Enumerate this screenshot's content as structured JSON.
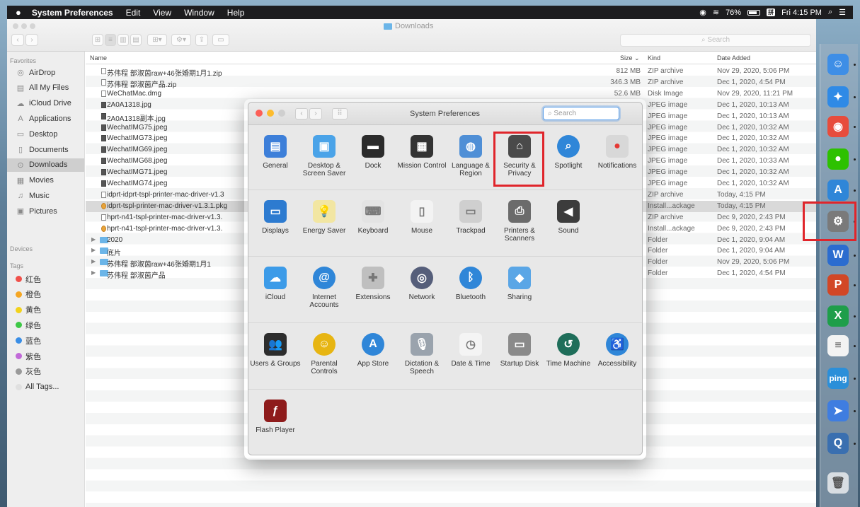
{
  "menubar": {
    "apple_icon": "apple-logo",
    "items": [
      "System Preferences",
      "Edit",
      "View",
      "Window",
      "Help"
    ],
    "battery": "76%",
    "clock": "Fri 4:15 PM"
  },
  "finder": {
    "title": "Downloads",
    "search_placeholder": "Search",
    "sidebar": {
      "favorites_header": "Favorites",
      "favorites": [
        {
          "label": "AirDrop",
          "icon": "airdrop-icon"
        },
        {
          "label": "All My Files",
          "icon": "files-icon"
        },
        {
          "label": "iCloud Drive",
          "icon": "cloud-icon"
        },
        {
          "label": "Applications",
          "icon": "applications-icon"
        },
        {
          "label": "Desktop",
          "icon": "desktop-icon"
        },
        {
          "label": "Documents",
          "icon": "documents-icon"
        },
        {
          "label": "Downloads",
          "icon": "downloads-icon"
        },
        {
          "label": "Movies",
          "icon": "movies-icon"
        },
        {
          "label": "Music",
          "icon": "music-icon"
        },
        {
          "label": "Pictures",
          "icon": "pictures-icon"
        }
      ],
      "devices_header": "Devices",
      "tags_header": "Tags",
      "tags": [
        {
          "label": "红色",
          "color": "#f0504a"
        },
        {
          "label": "橙色",
          "color": "#f5a623"
        },
        {
          "label": "黄色",
          "color": "#f2d21b"
        },
        {
          "label": "绿色",
          "color": "#3ec846"
        },
        {
          "label": "蓝色",
          "color": "#3a8ee6"
        },
        {
          "label": "紫色",
          "color": "#c16ad8"
        },
        {
          "label": "灰色",
          "color": "#9a9a9a"
        },
        {
          "label": "All Tags...",
          "color": "#e0e0e0"
        }
      ]
    },
    "columns": {
      "name": "Name",
      "size": "Size",
      "kind": "Kind",
      "date": "Date Added"
    },
    "files": [
      {
        "name": "苏伟程 部淑茵raw+46张婚期1月1.zip",
        "size": "812 MB",
        "kind": "ZIP archive",
        "date": "Nov 29, 2020, 5:06 PM",
        "type": "doc"
      },
      {
        "name": "苏伟程 部淑茵产品.zip",
        "size": "346.3 MB",
        "kind": "ZIP archive",
        "date": "Dec 1, 2020, 4:54 PM",
        "type": "doc"
      },
      {
        "name": "WeChatMac.dmg",
        "size": "52.6 MB",
        "kind": "Disk Image",
        "date": "Nov 29, 2020, 11:21 PM",
        "type": "doc"
      },
      {
        "name": "2A0A1318.jpg",
        "size": "",
        "kind": "JPEG image",
        "date": "Dec 1, 2020, 10:13 AM",
        "type": "img"
      },
      {
        "name": "2A0A1318副本.jpg",
        "size": "",
        "kind": "JPEG image",
        "date": "Dec 1, 2020, 10:13 AM",
        "type": "img"
      },
      {
        "name": "WechatIMG75.jpeg",
        "size": "",
        "kind": "JPEG image",
        "date": "Dec 1, 2020, 10:32 AM",
        "type": "img"
      },
      {
        "name": "WechatIMG73.jpeg",
        "size": "",
        "kind": "JPEG image",
        "date": "Dec 1, 2020, 10:32 AM",
        "type": "img"
      },
      {
        "name": "WechatIMG69.jpeg",
        "size": "",
        "kind": "JPEG image",
        "date": "Dec 1, 2020, 10:32 AM",
        "type": "img"
      },
      {
        "name": "WechatIMG68.jpeg",
        "size": "",
        "kind": "JPEG image",
        "date": "Dec 1, 2020, 10:33 AM",
        "type": "img"
      },
      {
        "name": "WechatIMG71.jpeg",
        "size": "",
        "kind": "JPEG image",
        "date": "Dec 1, 2020, 10:32 AM",
        "type": "img"
      },
      {
        "name": "WechatIMG74.jpeg",
        "size": "",
        "kind": "JPEG image",
        "date": "Dec 1, 2020, 10:32 AM",
        "type": "img"
      },
      {
        "name": "idprt-idprt-tspl-printer-mac-driver-v1.3",
        "size": "",
        "kind": "ZIP archive",
        "date": "Today, 4:15 PM",
        "type": "doc"
      },
      {
        "name": "idprt-tspl-printer-mac-driver-v1.3.1.pkg",
        "size": "",
        "kind": "Install...ackage",
        "date": "Today, 4:15 PM",
        "type": "pkg"
      },
      {
        "name": "hprt-n41-tspl-printer-mac-driver-v1.3.",
        "size": "",
        "kind": "ZIP archive",
        "date": "Dec 9, 2020, 2:43 PM",
        "type": "doc"
      },
      {
        "name": "hprt-n41-tspl-printer-mac-driver-v1.3.",
        "size": "",
        "kind": "Install...ackage",
        "date": "Dec 9, 2020, 2:43 PM",
        "type": "pkg"
      },
      {
        "name": "2020",
        "size": "",
        "kind": "Folder",
        "date": "Dec 1, 2020, 9:04 AM",
        "type": "dir"
      },
      {
        "name": "底片",
        "size": "",
        "kind": "Folder",
        "date": "Dec 1, 2020, 9:04 AM",
        "type": "dir"
      },
      {
        "name": "苏伟程 部淑茵raw+46张婚期1月1",
        "size": "",
        "kind": "Folder",
        "date": "Nov 29, 2020, 5:06 PM",
        "type": "dir"
      },
      {
        "name": "苏伟程 部淑茵产品",
        "size": "",
        "kind": "Folder",
        "date": "Dec 1, 2020, 4:54 PM",
        "type": "dir"
      }
    ]
  },
  "sysprefs": {
    "title": "System Preferences",
    "search_placeholder": "Search",
    "sections": [
      [
        {
          "label": "General",
          "icon": "general-icon",
          "color": "#3d7fd9"
        },
        {
          "label": "Desktop & Screen Saver",
          "icon": "desktop-screensaver-icon",
          "color": "#4aa3e8"
        },
        {
          "label": "Dock",
          "icon": "dock-icon",
          "color": "#2b2b2b"
        },
        {
          "label": "Mission Control",
          "icon": "mission-control-icon",
          "color": "#333333"
        },
        {
          "label": "Language & Region",
          "icon": "language-region-icon",
          "color": "#4f8fd6"
        },
        {
          "label": "Security & Privacy",
          "icon": "security-privacy-icon",
          "color": "#4a4a4a"
        },
        {
          "label": "Spotlight",
          "icon": "spotlight-icon",
          "color": "#2f86d8"
        },
        {
          "label": "Notifications",
          "icon": "notifications-icon",
          "color": "#d8d8d8"
        }
      ],
      [
        {
          "label": "Displays",
          "icon": "displays-icon",
          "color": "#2d7bd0"
        },
        {
          "label": "Energy Saver",
          "icon": "energy-saver-icon",
          "color": "#f2e6a2"
        },
        {
          "label": "Keyboard",
          "icon": "keyboard-icon",
          "color": "#e3e3e3"
        },
        {
          "label": "Mouse",
          "icon": "mouse-icon",
          "color": "#f3f3f3"
        },
        {
          "label": "Trackpad",
          "icon": "trackpad-icon",
          "color": "#cfcfcf"
        },
        {
          "label": "Printers & Scanners",
          "icon": "printer-icon",
          "color": "#6b6b6b"
        },
        {
          "label": "Sound",
          "icon": "sound-icon",
          "color": "#3c3c3c"
        }
      ],
      [
        {
          "label": "iCloud",
          "icon": "icloud-icon",
          "color": "#3c9be8"
        },
        {
          "label": "Internet Accounts",
          "icon": "internet-accounts-icon",
          "color": "#2f86d8"
        },
        {
          "label": "Extensions",
          "icon": "extensions-icon",
          "color": "#bfbfbf"
        },
        {
          "label": "Network",
          "icon": "network-icon",
          "color": "#555e7a"
        },
        {
          "label": "Bluetooth",
          "icon": "bluetooth-icon",
          "color": "#2f86d8"
        },
        {
          "label": "Sharing",
          "icon": "sharing-icon",
          "color": "#5aa6e6"
        }
      ],
      [
        {
          "label": "Users & Groups",
          "icon": "users-groups-icon",
          "color": "#2d2d2d"
        },
        {
          "label": "Parental Controls",
          "icon": "parental-controls-icon",
          "color": "#e7b512"
        },
        {
          "label": "App Store",
          "icon": "app-store-icon",
          "color": "#2f86d8"
        },
        {
          "label": "Dictation & Speech",
          "icon": "dictation-icon",
          "color": "#9aa3ad"
        },
        {
          "label": "Date & Time",
          "icon": "date-time-icon",
          "color": "#f4f4f4"
        },
        {
          "label": "Startup Disk",
          "icon": "startup-disk-icon",
          "color": "#8a8a8a"
        },
        {
          "label": "Time Machine",
          "icon": "time-machine-icon",
          "color": "#1f6e5a"
        },
        {
          "label": "Accessibility",
          "icon": "accessibility-icon",
          "color": "#2f86d8"
        }
      ],
      [
        {
          "label": "Flash Player",
          "icon": "flash-player-icon",
          "color": "#8e1b1b"
        }
      ]
    ]
  },
  "dock": [
    {
      "name": "finder-dock-icon",
      "color": "#3e8ee6",
      "glyph": "☺"
    },
    {
      "name": "safari-dock-icon",
      "color": "#2f8ae6",
      "glyph": "✦"
    },
    {
      "name": "chrome-dock-icon",
      "color": "#e74c3c",
      "glyph": "◉"
    },
    {
      "name": "wechat-dock-icon",
      "color": "#2dc100",
      "glyph": "●"
    },
    {
      "name": "app-store-dock-icon",
      "color": "#2f86d8",
      "glyph": "A"
    },
    {
      "name": "system-preferences-dock-icon",
      "color": "#7a7a7a",
      "glyph": "⚙"
    },
    {
      "name": "word-dock-icon",
      "color": "#2b6ccf",
      "glyph": "W"
    },
    {
      "name": "powerpoint-dock-icon",
      "color": "#d24726",
      "glyph": "P"
    },
    {
      "name": "excel-dock-icon",
      "color": "#1e9e4a",
      "glyph": "X"
    },
    {
      "name": "notes-dock-icon",
      "color": "#f3f3f3",
      "glyph": "≡"
    },
    {
      "name": "ping-dock-icon",
      "color": "#2b8fd9",
      "glyph": "ping"
    },
    {
      "name": "feishu-dock-icon",
      "color": "#3f7de0",
      "glyph": "➤"
    },
    {
      "name": "quicktime-dock-icon",
      "color": "#3a6fb0",
      "glyph": "Q"
    },
    {
      "name": "trash-dock-icon",
      "color": "#d8dde2",
      "glyph": "🗑"
    }
  ]
}
